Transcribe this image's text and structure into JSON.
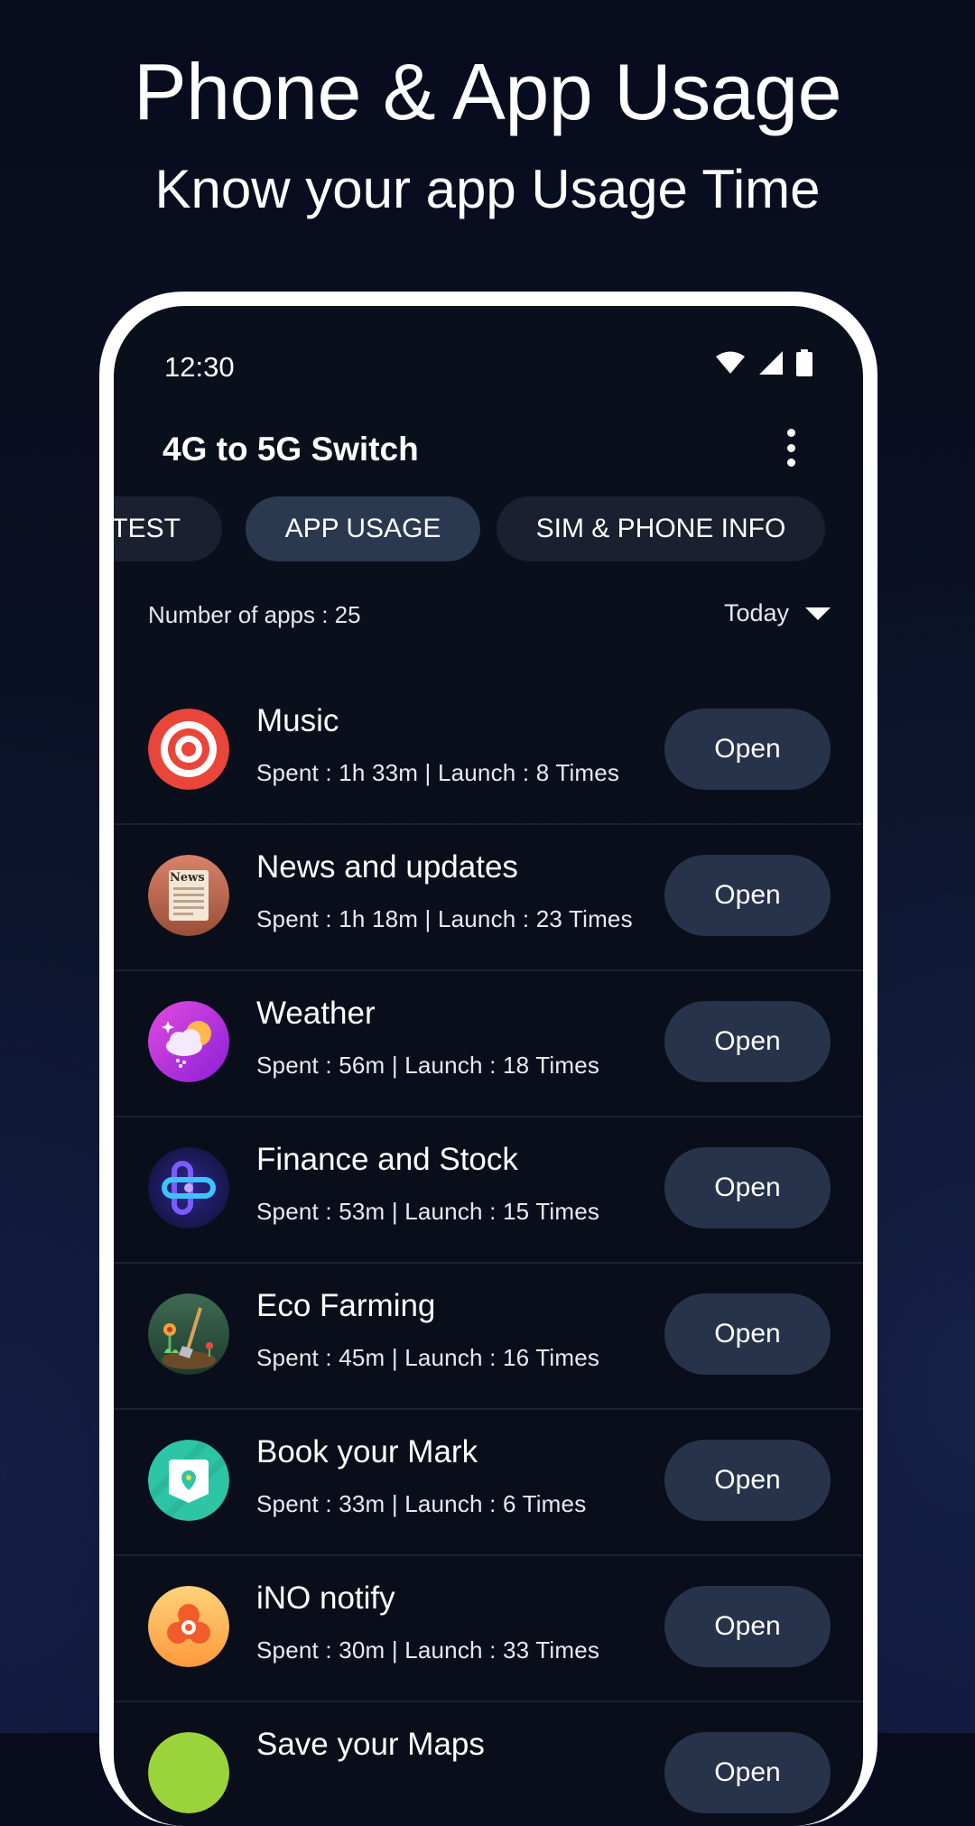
{
  "promo": {
    "title": "Phone & App Usage",
    "subtitle": "Know your app Usage Time"
  },
  "status_bar": {
    "time": "12:30",
    "icons": [
      "wifi-icon",
      "signal-icon",
      "battery-icon"
    ]
  },
  "app_bar": {
    "title": "4G to 5G Switch",
    "menu_icon": "more-vert-icon"
  },
  "tabs": [
    {
      "label": "TEST",
      "active": false
    },
    {
      "label": "APP USAGE",
      "active": true
    },
    {
      "label": "SIM & PHONE INFO",
      "active": false
    }
  ],
  "summary": {
    "count_label": "Number of apps : 25",
    "period": "Today"
  },
  "apps": [
    {
      "name": "Music",
      "stats": "Spent : 1h 33m | Launch : 8 Times",
      "button": "Open",
      "icon": "target-icon"
    },
    {
      "name": "News and updates",
      "stats": "Spent : 1h 18m | Launch : 23 Times",
      "button": "Open",
      "icon": "newspaper-icon",
      "icon_text": "News"
    },
    {
      "name": "Weather",
      "stats": "Spent : 56m | Launch : 18 Times",
      "button": "Open",
      "icon": "weather-icon"
    },
    {
      "name": "Finance and Stock",
      "stats": "Spent : 53m | Launch : 15 Times",
      "button": "Open",
      "icon": "finance-icon"
    },
    {
      "name": "Eco Farming",
      "stats": "Spent : 45m | Launch : 16 Times",
      "button": "Open",
      "icon": "farming-icon"
    },
    {
      "name": "Book your Mark",
      "stats": "Spent : 33m | Launch : 6 Times",
      "button": "Open",
      "icon": "map-pin-icon"
    },
    {
      "name": "iNO notify",
      "stats": "Spent : 30m | Launch : 33 Times",
      "button": "Open",
      "icon": "notify-icon"
    },
    {
      "name": "Save your Maps",
      "stats": "",
      "button": "Open",
      "icon": "maps-icon"
    }
  ],
  "colors": {
    "background": "#0a1024",
    "tab_inactive": "#1a2030",
    "tab_active": "#2a3850",
    "button": "#27334a"
  }
}
